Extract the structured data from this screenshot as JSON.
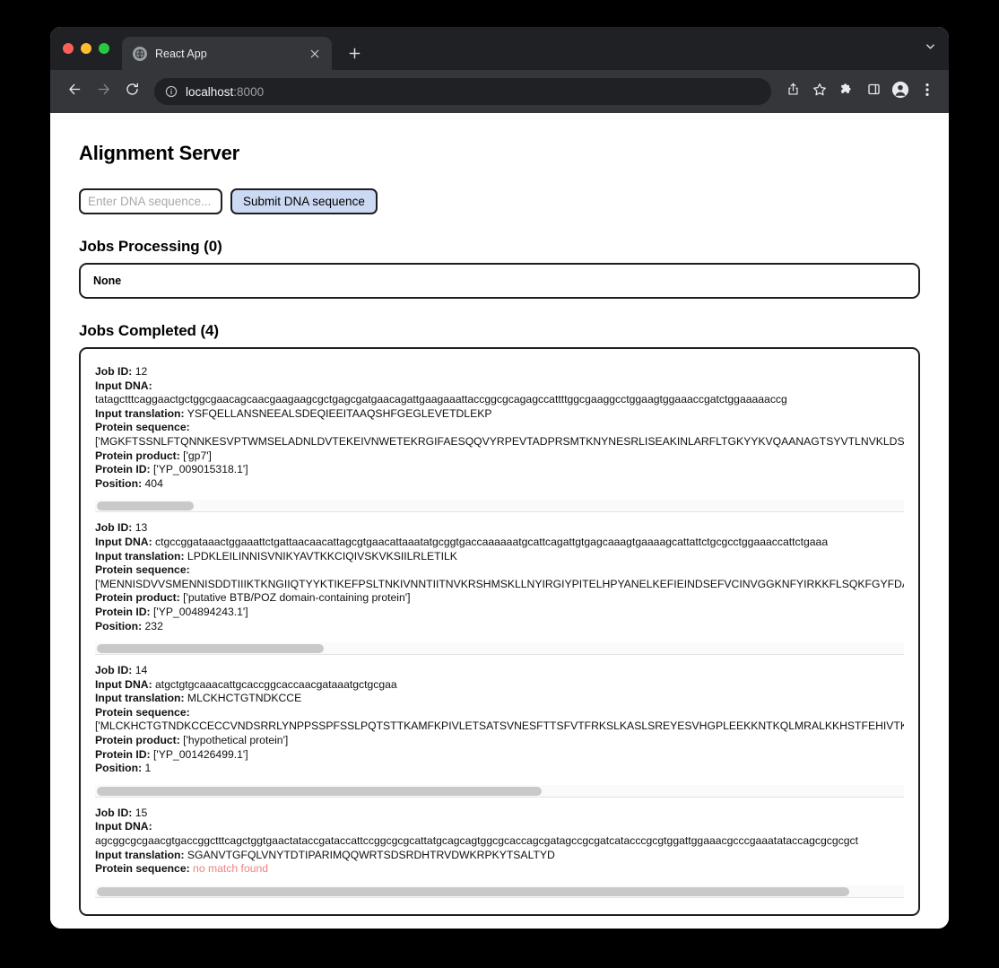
{
  "browser": {
    "tab_title": "React App",
    "tab_favicon_icon": "globe-icon",
    "tab_close_icon": "close-icon",
    "new_tab_icon": "plus-icon",
    "tabstrip_chevron_icon": "chevron-down-icon",
    "back_icon": "arrow-left-icon",
    "forward_icon": "arrow-right-icon",
    "reload_icon": "reload-icon",
    "site_info_icon": "info-circle-icon",
    "url_host": "localhost",
    "url_port": ":8000",
    "share_icon": "share-icon",
    "bookmark_icon": "star-icon",
    "extensions_icon": "puzzle-icon",
    "side_panel_icon": "side-panel-icon",
    "profile_icon": "person-icon",
    "menu_icon": "three-dot-menu-icon"
  },
  "page": {
    "title": "Alignment Server",
    "input_placeholder": "Enter DNA sequence...",
    "input_value": "",
    "submit_label": "Submit DNA sequence",
    "processing_title": "Jobs Processing (0)",
    "processing_empty": "None",
    "completed_title": "Jobs Completed (4)",
    "labels": {
      "job_id": "Job ID:",
      "input_dna": "Input DNA:",
      "input_translation": "Input translation:",
      "protein_sequence": "Protein sequence:",
      "protein_product": "Protein product:",
      "protein_id": "Protein ID:",
      "position": "Position:"
    },
    "jobs": [
      {
        "job_id": "12",
        "input_dna": "tatagctttcaggaactgctggcgaacagcaacgaagaagcgctgagcgatgaacagattgaagaaattaccggcgcagagccattttggcgaaggcctggaagtggaaaccgatctggaaaaaccg",
        "input_translation": "YSFQELLANSNEEALSDEQIEEITAAQSHFGEGLEVETDLEKP",
        "protein_sequence": "['MGKFTSSNLFTQNNKESVPTWMSELADNLDVTEKEIVNWETEKRGIFAESQQVYRPEVTADPRSMTKNYNESRLISEAKINLARFLTGKYYKVQAANAGTSYVTLNVKLDSIAAD",
        "protein_product": "['gp7']",
        "protein_id": "['YP_009015318.1']",
        "position": "404",
        "scroll_pct": 12,
        "dna_wrapped": true,
        "no_match": false
      },
      {
        "job_id": "13",
        "input_dna": "ctgccggataaactggaaattctgattaacaacattagcgtgaacattaaatatgcggtgaccaaaaaatgcattcagattgtgagcaaagtgaaaagcattattctgcgcctggaaaccattctgaaa",
        "input_translation": "LPDKLEILINNISVNIKYAVTKKCIQIVSKVKSIILRLETILK",
        "protein_sequence": "['MENNISDVVSMENNISDDTIIIKTKNGIIQTYYKTIKEFPSLTNKIVNNTIITNVKRSHMSKLLNYIRGIYPITELHPYANELKEFIEINDSEFVCINVGGKNFYIRKKFLSQKFGYFDAFFF",
        "protein_product": "['putative BTB/POZ domain-containing protein']",
        "protein_id": "['YP_004894243.1']",
        "position": "232",
        "scroll_pct": 28,
        "dna_wrapped": false,
        "no_match": false
      },
      {
        "job_id": "14",
        "input_dna": "atgctgtgcaaacattgcaccggcaccaacgataaatgctgcgaa",
        "input_translation": "MLCKHCTGTNDKCCE",
        "protein_sequence": "['MLCKHCTGTNDKCCECCVNDSRRLYNPPSSPFSSLPQTSTTKAMFKPIVLETSATSVNESFTTSFVTFRKSLKASLSREYESVHGPLEEKKNTKQLMRALKKHSTFEHIVTKGDD",
        "protein_product": "['hypothetical protein']",
        "protein_id": "['YP_001426499.1']",
        "position": "1",
        "scroll_pct": 55,
        "dna_wrapped": false,
        "no_match": false
      },
      {
        "job_id": "15",
        "input_dna": "agcggcgcgaacgtgaccggctttcagctggtgaactataccgataccattccggcgcgcattatgcagcagtggcgcaccagcgatagccgcgatcatacccgcgtggattggaaacgcccgaaatataccagcgcgcgct",
        "input_translation": "SGANVTGFQLVNYTDTIPARIMQQWRTSDSRDHTRVDWKRPKYTSALTYD",
        "protein_sequence": "no match found",
        "scroll_pct": 93,
        "dna_wrapped": true,
        "no_match": true
      }
    ]
  },
  "colors": {
    "submit_button_bg": "#ccd9f2",
    "border": "#1c1e21",
    "no_match_text": "#f08080",
    "scroll_thumb": "#c9c9c9",
    "browser_tabstrip": "#202124",
    "browser_toolbar": "#35363a"
  }
}
